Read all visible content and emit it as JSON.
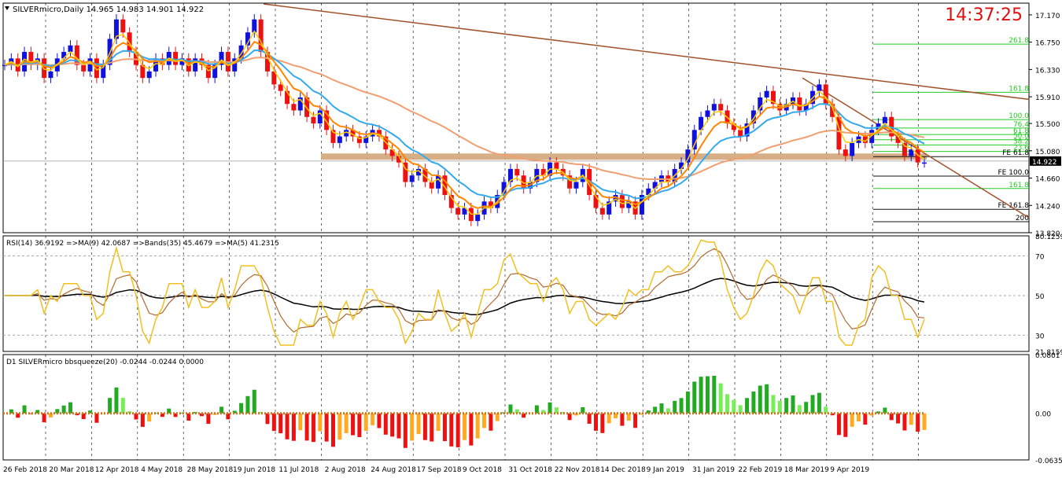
{
  "chart_data": [
    {
      "type": "candlestick",
      "title": "SILVERmicro,Daily",
      "ohlc_label": "14.965 14.983 14.901 14.922",
      "clock": "14:37:25",
      "price_axis": [
        "17.170",
        "16.750",
        "16.330",
        "15.910",
        "15.500",
        "15.080",
        "14.660",
        "14.240",
        "13.820"
      ],
      "ylim": [
        13.82,
        17.35
      ],
      "current_price": "14.922",
      "fib_levels": [
        {
          "label": "261.8",
          "value": 16.72,
          "color": "#22cc22"
        },
        {
          "label": "161.8",
          "value": 15.98,
          "color": "#22cc22"
        },
        {
          "label": "100.0",
          "value": 15.56,
          "color": "#22cc22"
        },
        {
          "label": "76.4",
          "value": 15.43,
          "color": "#22cc22"
        },
        {
          "label": "61.8",
          "value": 15.33,
          "color": "#22cc22"
        },
        {
          "label": "50.0",
          "value": 15.25,
          "color": "#22cc22"
        },
        {
          "label": "38.2",
          "value": 15.17,
          "color": "#22cc22"
        },
        {
          "label": "23.6",
          "value": 15.07,
          "color": "#22cc22"
        },
        {
          "label": "FE 61.8",
          "value": 14.99,
          "color": "#111111"
        },
        {
          "label": "FE 100.0",
          "value": 14.69,
          "color": "#111111"
        },
        {
          "label": "161.8",
          "value": 14.5,
          "color": "#22cc22"
        },
        {
          "label": "FE 161.8",
          "value": 14.18,
          "color": "#111111"
        },
        {
          "label": "200",
          "value": 13.99,
          "color": "#111111"
        }
      ],
      "colors": {
        "bull": "#1111dd",
        "bear": "#ee1111",
        "ema_fast": "#ffcc00",
        "ema_mid": "#ff8800",
        "ema_slow": "#f0a070",
        "ema_blue": "#33aaee",
        "trend": "#a0522d",
        "zone": "#d2a679",
        "fib": "#22cc22"
      },
      "closes": [
        16.4,
        16.5,
        16.3,
        16.6,
        16.4,
        16.5,
        16.2,
        16.3,
        16.5,
        16.6,
        16.7,
        16.4,
        16.3,
        16.5,
        16.2,
        16.4,
        16.8,
        17.1,
        16.9,
        16.6,
        16.4,
        16.2,
        16.3,
        16.5,
        16.4,
        16.6,
        16.4,
        16.5,
        16.3,
        16.5,
        16.4,
        16.2,
        16.4,
        16.6,
        16.3,
        16.5,
        16.7,
        16.9,
        17.1,
        16.6,
        16.3,
        16.1,
        16.0,
        15.8,
        15.7,
        15.9,
        15.6,
        15.5,
        15.7,
        15.4,
        15.2,
        15.3,
        15.4,
        15.3,
        15.2,
        15.3,
        15.4,
        15.3,
        15.1,
        15.0,
        14.9,
        14.6,
        14.7,
        14.8,
        14.6,
        14.5,
        14.7,
        14.4,
        14.2,
        14.1,
        14.2,
        14.0,
        14.1,
        14.3,
        14.2,
        14.4,
        14.6,
        14.8,
        14.7,
        14.5,
        14.6,
        14.8,
        14.7,
        14.9,
        14.8,
        14.7,
        14.5,
        14.6,
        14.8,
        14.4,
        14.2,
        14.1,
        14.3,
        14.4,
        14.2,
        14.3,
        14.1,
        14.4,
        14.5,
        14.6,
        14.7,
        14.6,
        14.8,
        14.9,
        15.1,
        15.4,
        15.6,
        15.7,
        15.8,
        15.7,
        15.5,
        15.4,
        15.3,
        15.5,
        15.7,
        15.9,
        16.0,
        15.8,
        15.7,
        15.8,
        15.9,
        15.7,
        15.8,
        16.0,
        16.1,
        15.8,
        15.6,
        15.1,
        15.0,
        15.2,
        15.3,
        15.2,
        15.4,
        15.5,
        15.6,
        15.3,
        15.2,
        15.0,
        15.1,
        14.9,
        14.9
      ],
      "rsi": {
        "label": "RSI(14) 36.9192 =>MA(9) 42.0687 =>Bands(35) 45.4679 =>MA(5) 41.2315",
        "ticks": [
          "80.1259",
          "70",
          "50",
          "30",
          "21.8159"
        ],
        "ylim": [
          21.8159,
          80.1259
        ]
      },
      "squeeze": {
        "label": "D1 SILVERmicro bbsqueeze(20) -0.0244 -0.0244 0.0000",
        "ticks": [
          "0.0801",
          "0.00",
          "-0.0635"
        ],
        "ylim": [
          -0.0635,
          0.0801
        ]
      },
      "dates": [
        "26 Feb 2018",
        "20 Mar 2018",
        "12 Apr 2018",
        "4 May 2018",
        "28 May 2018",
        "19 Jun 2018",
        "11 Jul 2018",
        "2 Aug 2018",
        "24 Aug 2018",
        "17 Sep 2018",
        "9 Oct 2018",
        "31 Oct 2018",
        "22 Nov 2018",
        "14 Dec 2018",
        "9 Jan 2019",
        "31 Jan 2019",
        "22 Feb 2019",
        "18 Mar 2019",
        "9 Apr 2019"
      ]
    }
  ]
}
